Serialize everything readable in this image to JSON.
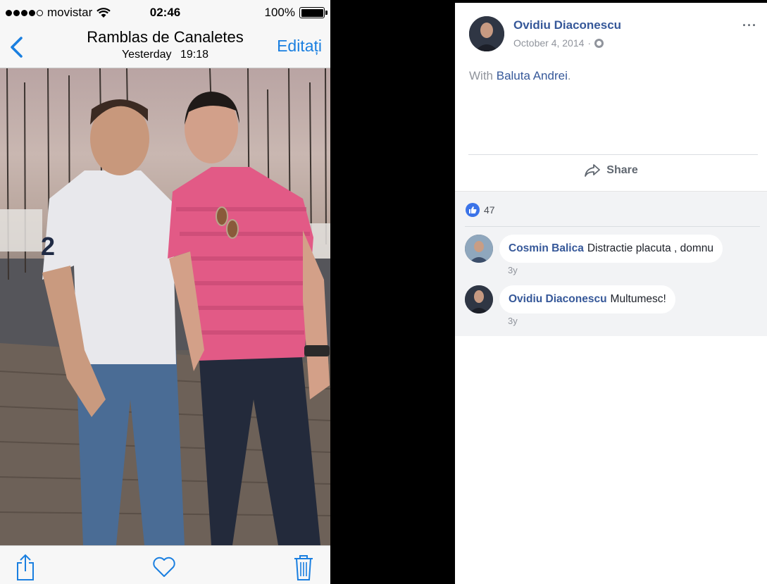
{
  "phone": {
    "status": {
      "carrier": "movistar",
      "signal_dots": [
        true,
        true,
        true,
        true,
        false
      ],
      "time": "02:46",
      "battery_percent_label": "100%",
      "battery_level": 1.0
    },
    "nav": {
      "back_icon": "chevron-left-icon",
      "title": "Ramblas de Canaletes",
      "subtitle_day": "Yesterday",
      "subtitle_time": "19:18",
      "edit_label": "Editați"
    },
    "toolbar": {
      "share_icon": "share-icon",
      "favorite_icon": "heart-icon",
      "delete_icon": "trash-icon"
    },
    "accent_color": "#1a7fe0"
  },
  "facebook": {
    "post": {
      "author": "Ovidiu Diaconescu",
      "date": "October 4, 2014",
      "separator": "·",
      "privacy_icon": "globe-icon",
      "more_label": "···",
      "with_prefix": "With",
      "tagged_person": "Baluta Andrei",
      "with_suffix": ".",
      "share_label": "Share"
    },
    "reactions": {
      "icon": "thumbs-up-icon",
      "count": "47"
    },
    "comments": [
      {
        "name": "Cosmin Balica",
        "text": "Distractie placuta , domnu",
        "time": "3y"
      },
      {
        "name": "Ovidiu Diaconescu",
        "text": "Multumesc!",
        "time": "3y"
      }
    ],
    "link_color": "#365899"
  }
}
